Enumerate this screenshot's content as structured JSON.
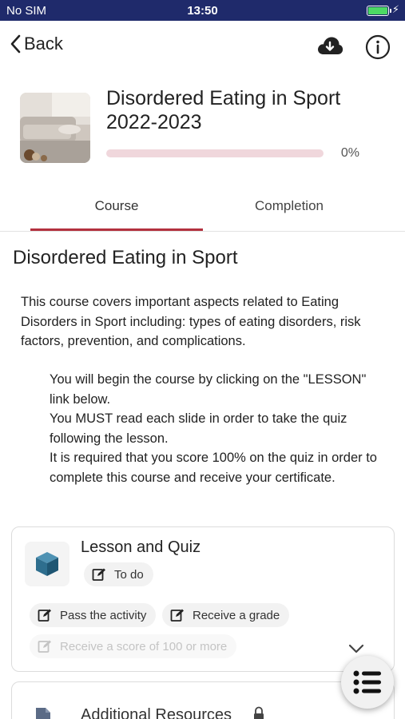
{
  "status_bar": {
    "carrier": "No SIM",
    "time": "13:50"
  },
  "nav": {
    "back_label": "Back",
    "icons": [
      "cloud-download-icon",
      "info-icon"
    ]
  },
  "course": {
    "title": "Disordered Eating in Sport 2022-2023",
    "progress_label": "0%",
    "progress_value": 0
  },
  "tabs": [
    {
      "label": "Course",
      "selected": true
    },
    {
      "label": "Completion",
      "selected": false
    }
  ],
  "section": {
    "title": "Disordered Eating in Sport",
    "summary": "This course covers important aspects related to Eating Disorders in Sport including: types of eating disorders, risk factors, prevention, and complications.",
    "instructions": [
      "You will begin the course by clicking on the \"LESSON\" link below.",
      "You MUST read each slide in order to take the quiz following the lesson.",
      "It is required that you score 100% on the quiz in order to complete this course and receive your certificate."
    ]
  },
  "activity": {
    "title": "Lesson and Quiz",
    "status": "To do",
    "conditions": [
      "Pass the activity",
      "Receive a grade",
      "Receive a score of 100 or more"
    ]
  },
  "next_activity": {
    "title": "Additional Resources"
  },
  "colors": {
    "accent": "#b3303e",
    "status_bar": "#1f2a6b",
    "battery": "#4cd964"
  }
}
